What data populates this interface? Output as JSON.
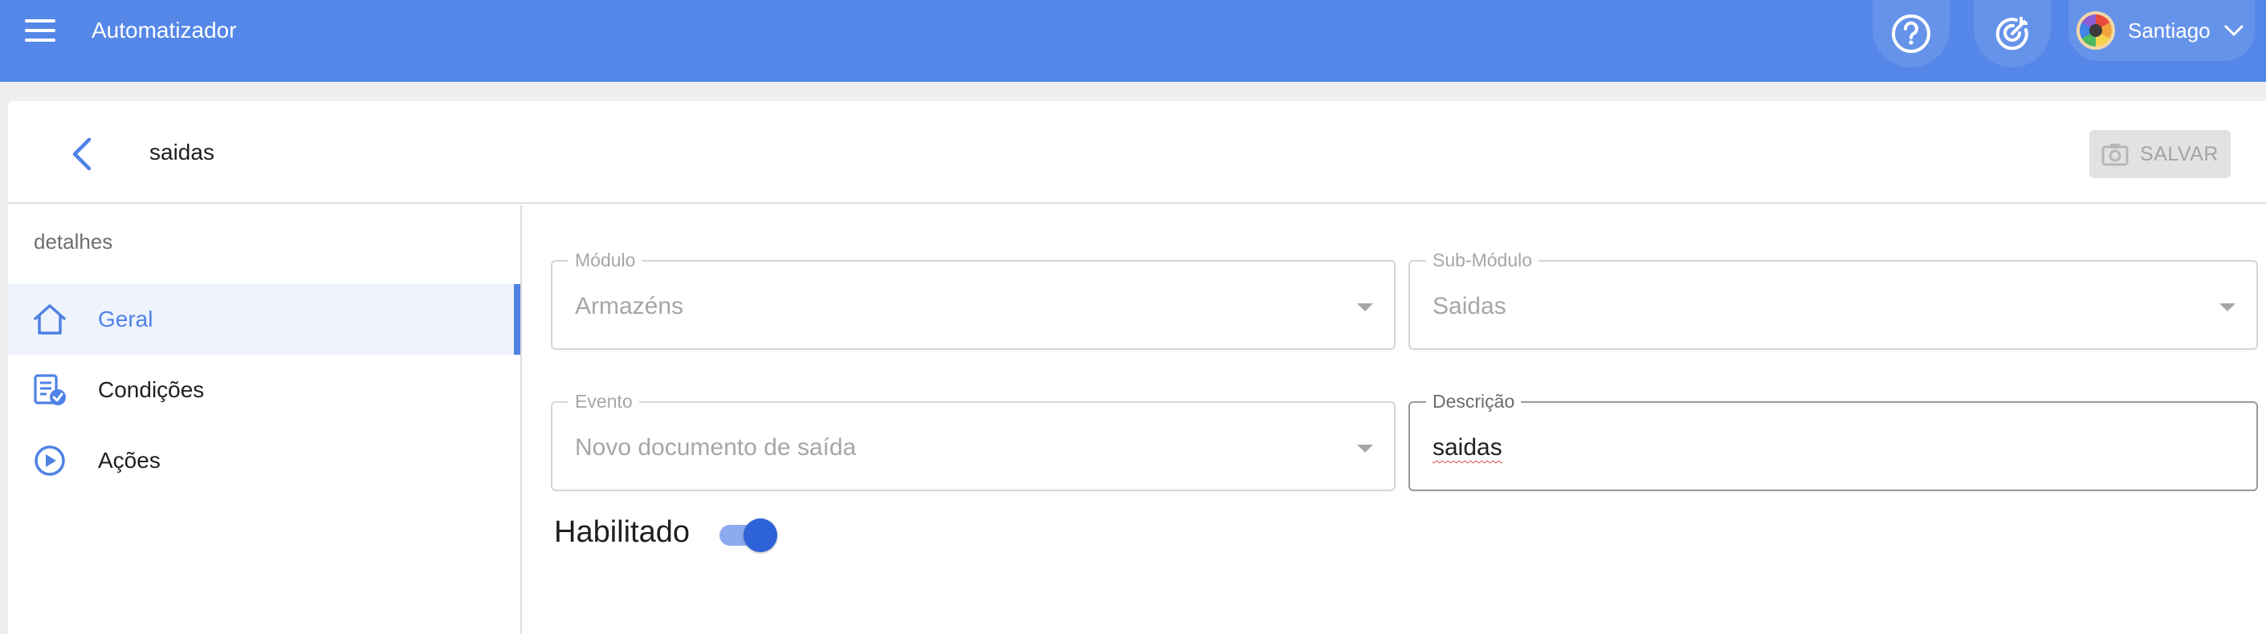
{
  "appbar": {
    "title": "Automatizador",
    "menu_icon": "hamburger-menu-icon",
    "help_icon": "help-circle-icon",
    "target_icon": "target-icon",
    "user": {
      "name": "Santiago",
      "avatar_icon": "avatar",
      "chevron_icon": "chevron-down-icon"
    }
  },
  "header": {
    "back_icon": "chevron-left-icon",
    "title": "saidas",
    "save_label": "SALVAR",
    "save_icon": "camera-icon",
    "save_disabled": true
  },
  "sidebar": {
    "heading": "detalhes",
    "items": [
      {
        "label": "Geral",
        "icon": "home-icon",
        "active": true
      },
      {
        "label": "Condições",
        "icon": "checklist-icon",
        "active": false
      },
      {
        "label": "Ações",
        "icon": "play-circle-icon",
        "active": false
      }
    ]
  },
  "form": {
    "modulo": {
      "label": "Módulo",
      "value": "Armazéns",
      "disabled": true
    },
    "submodulo": {
      "label": "Sub-Módulo",
      "value": "Saidas",
      "disabled": true
    },
    "evento": {
      "label": "Evento",
      "value": "Novo documento de saída",
      "disabled": true
    },
    "descricao": {
      "label": "Descrição",
      "value": "saidas"
    },
    "habilitado": {
      "label": "Habilitado",
      "checked": true
    }
  },
  "colors": {
    "appbar": "#5587e8",
    "accent": "#4f82e4",
    "toggle_on": "#2e62d8",
    "background": "#efeff1"
  }
}
